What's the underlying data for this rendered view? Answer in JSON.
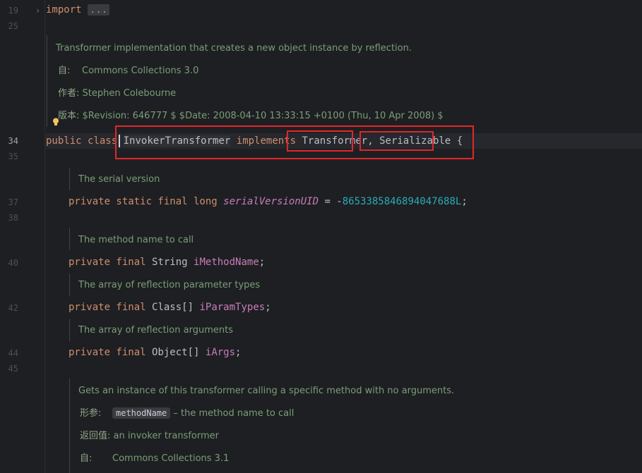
{
  "gutter": {
    "lines": [
      "19",
      "25",
      "34",
      "35",
      "37",
      "38",
      "40",
      "42",
      "44",
      "45"
    ]
  },
  "code": {
    "import_kw": "import",
    "import_folded": "...",
    "class_line": {
      "public": "public",
      "class": "class",
      "name": "InvokerTransformer",
      "implements": "implements",
      "iface1": "Transformer",
      "comma": ",",
      "iface2": "Serializable",
      "brace": "{"
    },
    "serial_line": {
      "mods": "private static final long",
      "field": "serialVersionUID",
      "eq": " = -",
      "value": "8653385846894047688L",
      "semi": ";"
    },
    "method_name_line": {
      "mods": "private final",
      "type": "String",
      "field": "iMethodName",
      "semi": ";"
    },
    "param_types_line": {
      "mods": "private final",
      "type": "Class[]",
      "field": "iParamTypes",
      "semi": ";"
    },
    "args_line": {
      "mods": "private final",
      "type": "Object[]",
      "field": "iArgs",
      "semi": ";"
    }
  },
  "docs": {
    "class_doc": {
      "summary": "Transformer implementation that creates a new object instance by reflection.",
      "since_label": "自:",
      "since_value": "Commons Collections 3.0",
      "author_label": "作者:",
      "author_value": "Stephen Colebourne",
      "version_label": "版本:",
      "version_value": "$Revision: 646777 $ $Date: 2008-04-10 13:33:15 +0100 (Thu, 10 Apr 2008) $"
    },
    "serial_doc": "The serial version",
    "method_name_doc": "The method name to call",
    "param_types_doc": "The array of reflection parameter types",
    "args_doc": "The array of reflection arguments",
    "get_instance_doc": {
      "summary": "Gets an instance of this transformer calling a specific method with no arguments.",
      "param_label": "形参:",
      "param_name": "methodName",
      "param_desc": "– the method name to call",
      "return_label": "返回值:",
      "return_value": "an invoker transformer",
      "since_label": "自:",
      "since_value": "Commons Collections 3.1"
    }
  },
  "colors": {
    "background": "#1e1f22",
    "keyword": "#cf8e6d",
    "field": "#c77dbb",
    "number": "#2aacb8",
    "doc_text": "#7a9e79",
    "highlight_box": "#e3262b"
  }
}
